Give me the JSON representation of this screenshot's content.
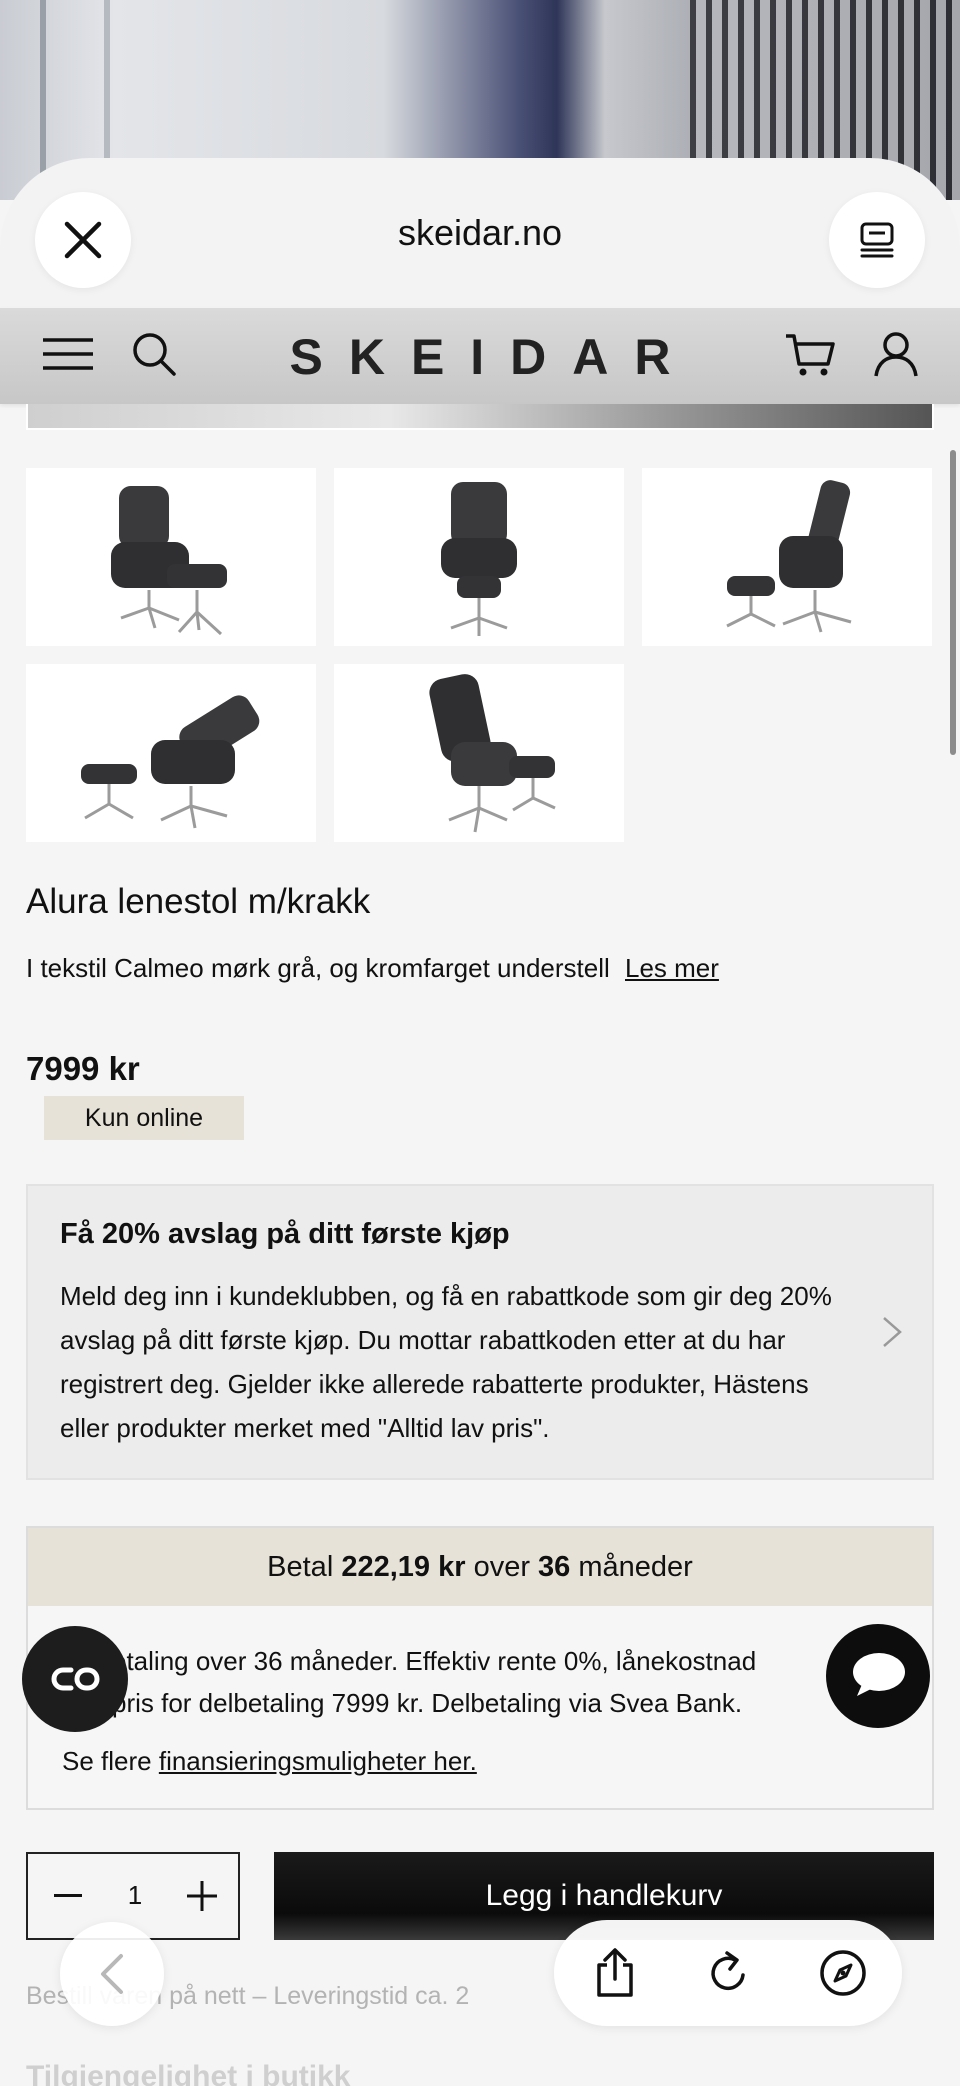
{
  "browser": {
    "url": "skeidar.no"
  },
  "site": {
    "logo": "SKEIDAR"
  },
  "gallery": {
    "images": [
      {
        "alt": "chair-front-angle"
      },
      {
        "alt": "chair-front"
      },
      {
        "alt": "chair-side"
      },
      {
        "alt": "chair-reclined"
      },
      {
        "alt": "chair-back"
      }
    ]
  },
  "product": {
    "title": "Alura lenestol m/krakk",
    "description": "I tekstil Calmeo mørk grå, og kromfarget understell",
    "read_more": "Les mer",
    "price": "7999 kr",
    "badge": "Kun online"
  },
  "promo": {
    "heading": "Få 20% avslag på ditt første kjøp",
    "body": "Meld deg inn i kundeklubben, og få en rabattkode som gir deg 20% avslag på ditt første kjøp. Du mottar rabattkoden etter at du har registrert deg. Gjelder ikke allerede rabatterte produkter, Hästens eller produkter merket med \"Alltid lav pris\"."
  },
  "payment": {
    "prefix": "Betal",
    "amount": "222,19 kr",
    "middle": "over",
    "months": "36",
    "suffix": "måneder",
    "details": "Delbetaling over 36 måneder. Effektiv rente 0%, lånekostnad 0 kr, totalpris for delbetaling 7999 kr. Delbetaling via Svea Bank.",
    "details_line1": "etaling over 36 måneder. Effektiv rente 0%, lånekostnad",
    "details_line2": "pris for delbetaling 7999 kr. Delbetaling via Svea Bank.",
    "link_prefix": "Se flere",
    "link_text": "finansieringsmuligheter her."
  },
  "cart": {
    "quantity": "1",
    "button_label": "Legg i handlekurv"
  },
  "delivery": {
    "text": "Bestill varen på nett – Leveringstid ca. 2"
  },
  "store": {
    "heading": "Tilgjengelighet i butikk"
  },
  "icons": {
    "close": "close-icon",
    "tabs": "tabs-icon",
    "menu": "hamburger-menu-icon",
    "search": "search-icon",
    "cart": "cart-icon",
    "account": "user-icon",
    "chevron": "chevron-right-icon",
    "chat": "chat-bubble-icon",
    "co": "co-browse-icon",
    "back": "chevron-left-icon",
    "share": "share-icon",
    "reload": "reload-icon",
    "compass": "compass-icon"
  },
  "colors": {
    "beige": "#e7e2d8",
    "dark": "#111111",
    "page": "#f5f5f5"
  }
}
